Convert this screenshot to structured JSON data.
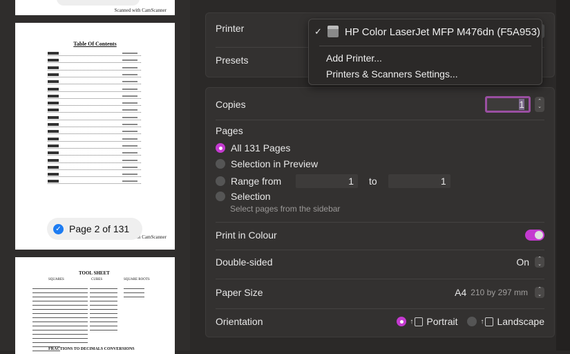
{
  "sidebar": {
    "thumb1": {
      "footer": "Scanned with CamScanner"
    },
    "thumb2": {
      "title": "Table Of Contents",
      "footer": "Scanned with CamScanner",
      "selected_label": "Page 2 of 131"
    },
    "thumb3": {
      "title": "TOOL SHEET",
      "headings": [
        "SQUARES",
        "CUBES",
        "SQUARE ROOTS"
      ],
      "bottom": "FRACTIONS TO DECIMALS CONVERSIONS"
    }
  },
  "printer": {
    "label": "Printer",
    "presets_label": "Presets",
    "menu": {
      "selected": "HP Color LaserJet MFP M476dn (F5A953)",
      "items": [
        "Add Printer...",
        "Printers & Scanners Settings..."
      ]
    }
  },
  "copies": {
    "label": "Copies",
    "value": "1"
  },
  "pages": {
    "label": "Pages",
    "options": [
      "All 131 Pages",
      "Selection in Preview",
      "Range from",
      "Selection"
    ],
    "selected": "All 131 Pages",
    "range_from": "1",
    "range_to_label": "to",
    "range_to": "1",
    "selection_hint": "Select pages from the sidebar"
  },
  "colour": {
    "label": "Print in Colour",
    "enabled": true
  },
  "double_sided": {
    "label": "Double-sided",
    "value": "On"
  },
  "paper": {
    "label": "Paper Size",
    "value": "A4",
    "dims": "210 by 297 mm"
  },
  "orientation": {
    "label": "Orientation",
    "options": [
      "Portrait",
      "Landscape"
    ],
    "selected": "Portrait"
  },
  "colors": {
    "accent": "#c43ad0",
    "check": "#1d7cf2"
  }
}
